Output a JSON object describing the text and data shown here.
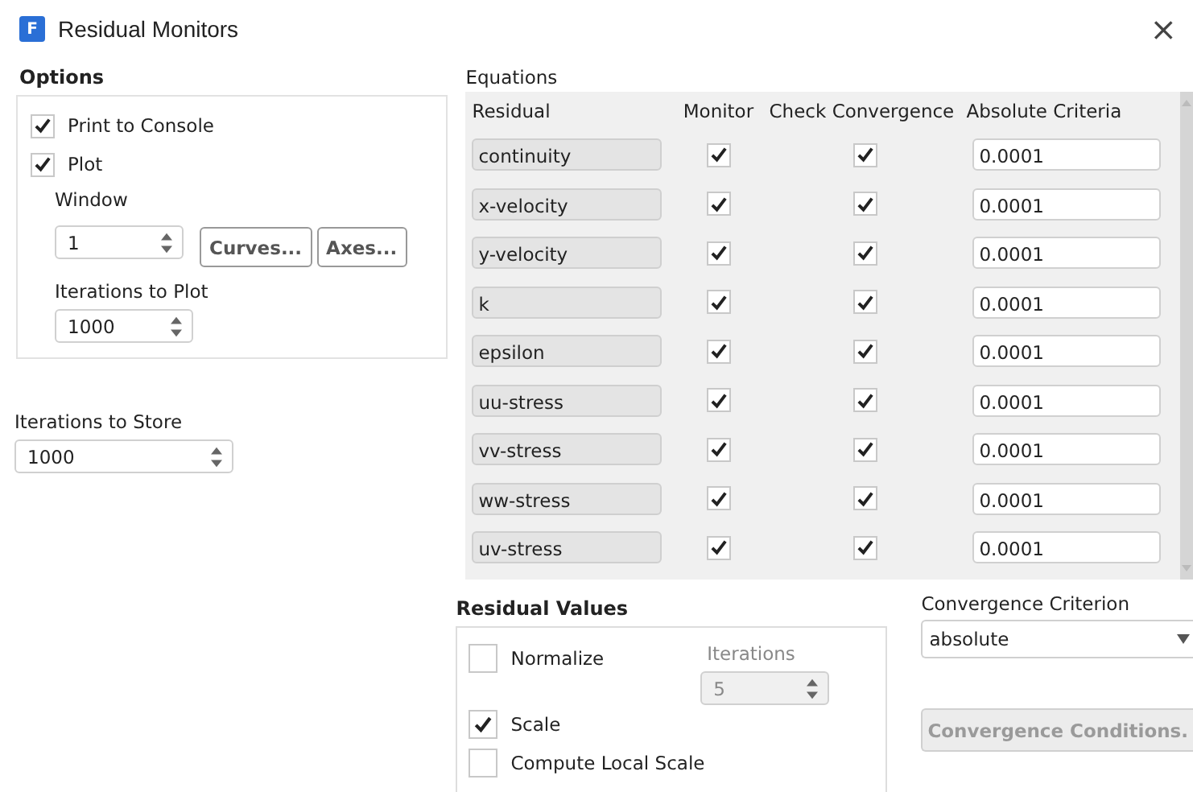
{
  "window": {
    "logo": "F",
    "title": "Residual Monitors",
    "close": "×"
  },
  "options": {
    "title": "Options",
    "checkboxes": [
      {
        "label": "Print to Console",
        "checked": true
      },
      {
        "label": "Plot",
        "checked": true
      }
    ],
    "window_label": "Window",
    "window_value": "1",
    "buttons": [
      "Curves...",
      "Axes..."
    ],
    "iterations_to_plot_label": "Iterations to Plot",
    "iterations_to_plot": "1000"
  },
  "iterations_to_store": {
    "label": "Iterations to Store",
    "value": "1000"
  },
  "equations": {
    "title": "Equations",
    "columns": [
      "Residual",
      "Monitor",
      "Check Convergence",
      "Absolute Criteria"
    ],
    "rows": [
      {
        "residual": "continuity",
        "monitor": true,
        "check_convergence": true,
        "absolute_criteria": "0.0001"
      },
      {
        "residual": "x-velocity",
        "monitor": true,
        "check_convergence": true,
        "absolute_criteria": "0.0001"
      },
      {
        "residual": "y-velocity",
        "monitor": true,
        "check_convergence": true,
        "absolute_criteria": "0.0001"
      },
      {
        "residual": "k",
        "monitor": true,
        "check_convergence": true,
        "absolute_criteria": "0.0001"
      },
      {
        "residual": "epsilon",
        "monitor": true,
        "check_convergence": true,
        "absolute_criteria": "0.0001"
      },
      {
        "residual": "uu-stress",
        "monitor": true,
        "check_convergence": true,
        "absolute_criteria": "0.0001"
      },
      {
        "residual": "vv-stress",
        "monitor": true,
        "check_convergence": true,
        "absolute_criteria": "0.0001"
      },
      {
        "residual": "ww-stress",
        "monitor": true,
        "check_convergence": true,
        "absolute_criteria": "0.0001"
      },
      {
        "residual": "uv-stress",
        "monitor": true,
        "check_convergence": true,
        "absolute_criteria": "0.0001"
      }
    ]
  },
  "residual_values": {
    "title": "Residual Values",
    "normalize": {
      "label": "Normalize",
      "checked": false
    },
    "iterations": {
      "label": "Iterations",
      "value": "5",
      "disabled": true
    },
    "scale": {
      "label": "Scale",
      "checked": true
    },
    "compute_local_scale": {
      "label": "Compute Local Scale",
      "checked": false
    }
  },
  "convergence_criterion": {
    "label": "Convergence Criterion",
    "value": "absolute"
  },
  "convergence_conditions_button": {
    "label": "Convergence Conditions.",
    "disabled": true
  }
}
